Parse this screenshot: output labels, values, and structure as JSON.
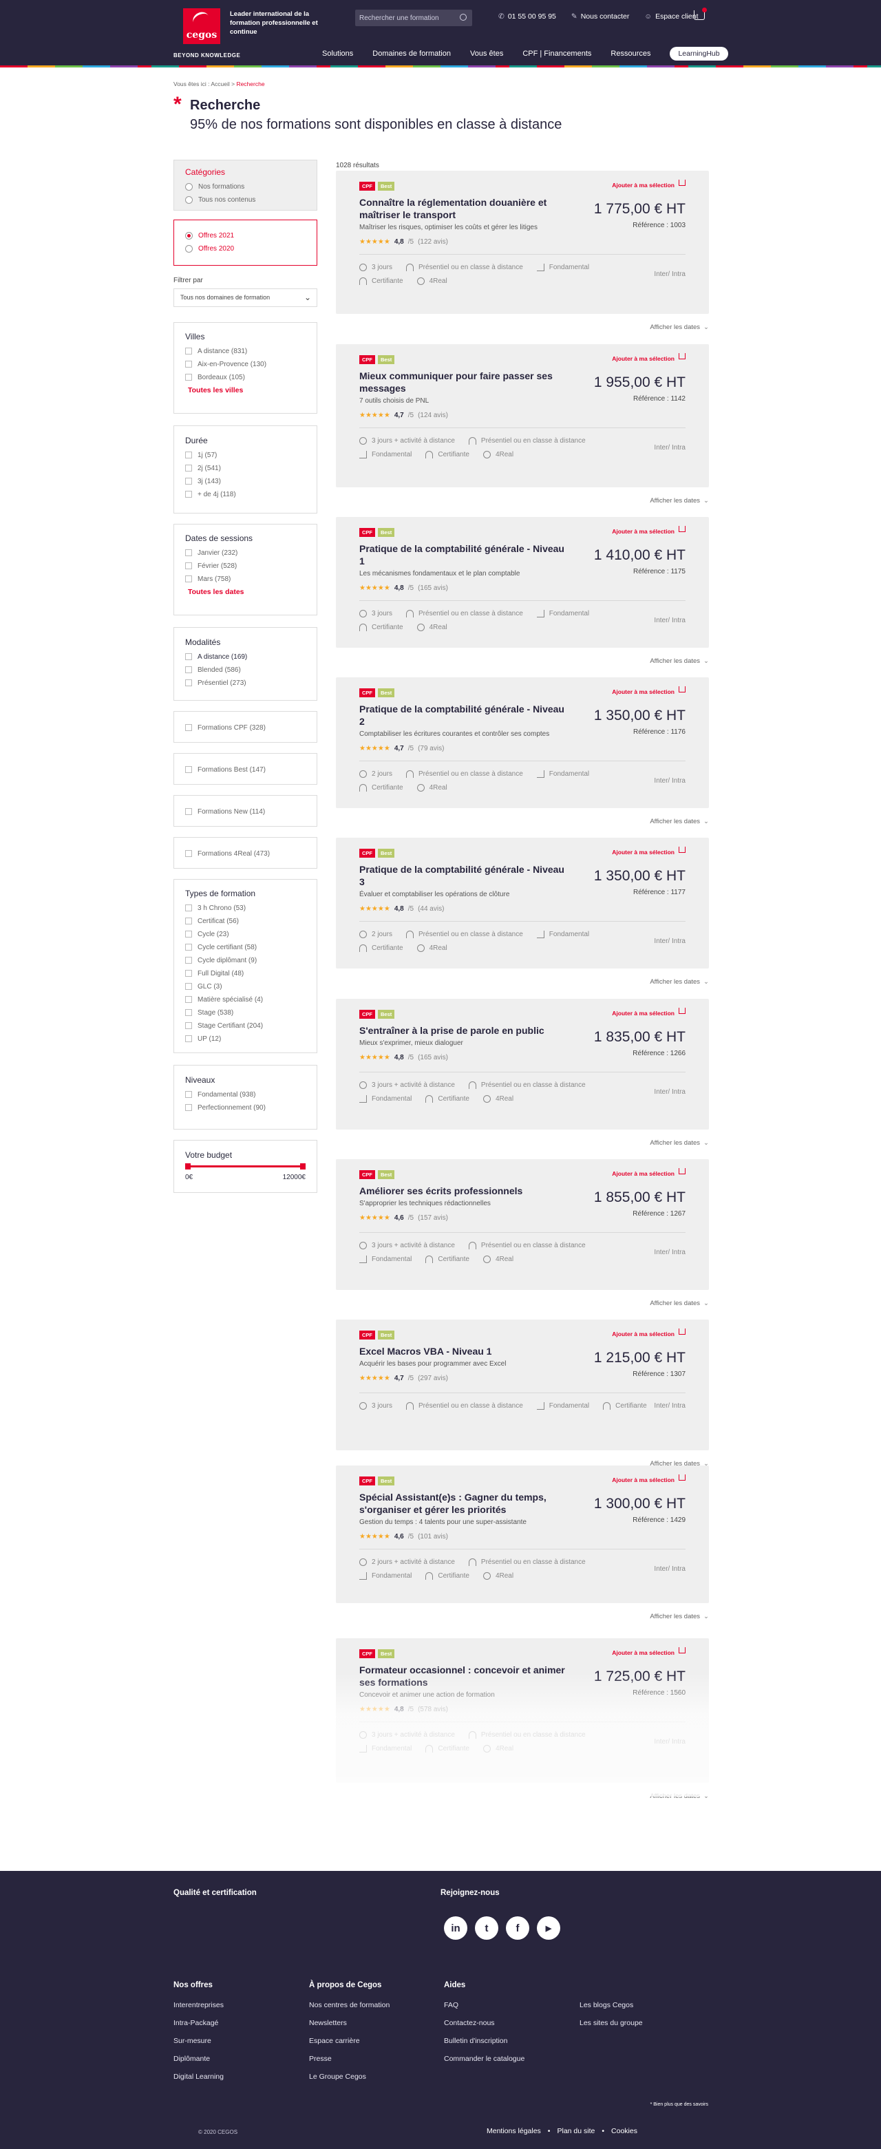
{
  "header": {
    "tagline": "Leader international de la formation professionnelle et continue",
    "logo_text": "cegos",
    "logo_sub": "BEYOND KNOWLEDGE",
    "search_placeholder": "Rechercher une formation",
    "phone": "01 55 00 95 95",
    "contact": "Nous contacter",
    "client": "Espace client",
    "nav": [
      "Solutions",
      "Domaines de formation",
      "Vous êtes",
      "CPF | Financements",
      "Ressources"
    ],
    "hub": "LearningHub"
  },
  "breadcrumb": {
    "prefix": "Vous êtes ici : ",
    "home": "Accueil",
    "sep": " > ",
    "current": "Recherche"
  },
  "page": {
    "title": "Recherche",
    "subtitle": "95% de nos formations sont disponibles en classe à distance",
    "results": "1028 résultats"
  },
  "sidebar": {
    "categories": {
      "title": "Catégories",
      "options": [
        "Nos formations",
        "Tous nos contenus"
      ]
    },
    "offers": [
      "Offres 2021",
      "Offres 2020"
    ],
    "filter_label": "Filtrer par",
    "filter_value": "Tous nos domaines de formation",
    "villes": {
      "title": "Villes",
      "items": [
        "A distance (831)",
        "Aix-en-Provence (130)",
        "Bordeaux (105)"
      ],
      "more": "Toutes les villes"
    },
    "duree": {
      "title": "Durée",
      "items": [
        "1j (57)",
        "2j (541)",
        "3j (143)",
        "+ de 4j (118)"
      ]
    },
    "sessions": {
      "title": "Dates de sessions",
      "items": [
        "Janvier (232)",
        "Février (528)",
        "Mars (758)"
      ],
      "more": "Toutes les dates"
    },
    "modalites": {
      "title": "Modalités",
      "items": [
        "A distance (169)",
        "Blended (586)",
        "Présentiel (273)"
      ]
    },
    "singles": [
      "Formations CPF (328)",
      "Formations Best (147)",
      "Formations New (114)",
      "Formations 4Real (473)"
    ],
    "types": {
      "title": "Types de formation",
      "items": [
        "3 h Chrono (53)",
        "Certificat (56)",
        "Cycle (23)",
        "Cycle certifiant (58)",
        "Cycle diplômant (9)",
        "Full Digital (48)",
        "GLC (3)",
        "Matière spécialisé (4)",
        "Stage (538)",
        "Stage Certifiant (204)",
        "UP (12)"
      ]
    },
    "niveaux": {
      "title": "Niveaux",
      "items": [
        "Fondamental (938)",
        "Perfectionnement (90)"
      ]
    },
    "budget": {
      "title": "Votre budget",
      "min": "0€",
      "max": "12000€"
    }
  },
  "card_common": {
    "cpf": "CPF",
    "best": "Best",
    "add": "Ajouter à ma sélection",
    "inter": "Inter/ Intra",
    "dates": "Afficher les dates",
    "stars": "★★★★★"
  },
  "cards": [
    {
      "title": "Connaître la réglementation douanière et maîtriser le transport",
      "sub": "Maîtriser les risques, optimiser les coûts et gérer les litiges",
      "rating": "4,8",
      "count": "(122 avis)",
      "price": "1 775,00 € HT",
      "ref": "Référence : 1003",
      "meta1": [
        "3 jours",
        "Présentiel ou en classe à distance",
        "Fondamental"
      ],
      "meta2": [
        "Certifiante",
        "4Real"
      ]
    },
    {
      "title": "Mieux communiquer pour faire passer ses messages",
      "sub": "7 outils choisis de PNL",
      "rating": "4,7",
      "count": "(124 avis)",
      "price": "1 955,00 € HT",
      "ref": "Référence : 1142",
      "meta1": [
        "3 jours + activité à distance",
        "Présentiel ou en classe à distance"
      ],
      "meta2": [
        "Fondamental",
        "Certifiante",
        "4Real"
      ]
    },
    {
      "title": "Pratique de la comptabilité générale - Niveau 1",
      "sub": "Les mécanismes fondamentaux et le plan comptable",
      "rating": "4,8",
      "count": "(165 avis)",
      "price": "1 410,00 € HT",
      "ref": "Référence : 1175",
      "meta1": [
        "3 jours",
        "Présentiel ou en classe à distance",
        "Fondamental"
      ],
      "meta2": [
        "Certifiante",
        "4Real"
      ]
    },
    {
      "title": "Pratique de la comptabilité générale - Niveau 2",
      "sub": "Comptabiliser les écritures courantes et contrôler ses comptes",
      "rating": "4,7",
      "count": "(79 avis)",
      "price": "1 350,00 € HT",
      "ref": "Référence : 1176",
      "meta1": [
        "2 jours",
        "Présentiel ou en classe à distance",
        "Fondamental"
      ],
      "meta2": [
        "Certifiante",
        "4Real"
      ]
    },
    {
      "title": "Pratique de la comptabilité générale - Niveau 3",
      "sub": "Évaluer et comptabiliser les opérations de clôture",
      "rating": "4,8",
      "count": "(44 avis)",
      "price": "1 350,00 € HT",
      "ref": "Référence : 1177",
      "meta1": [
        "2 jours",
        "Présentiel ou en classe à distance",
        "Fondamental"
      ],
      "meta2": [
        "Certifiante",
        "4Real"
      ]
    },
    {
      "title": "S'entraîner à la prise de parole en public",
      "sub": "Mieux s'exprimer, mieux dialoguer",
      "rating": "4,8",
      "count": "(165 avis)",
      "price": "1 835,00 € HT",
      "ref": "Référence : 1266",
      "meta1": [
        "3 jours + activité à distance",
        "Présentiel ou en classe à distance"
      ],
      "meta2": [
        "Fondamental",
        "Certifiante",
        "4Real"
      ]
    },
    {
      "title": "Améliorer ses écrits professionnels",
      "sub": "S'approprier les techniques rédactionnelles",
      "rating": "4,6",
      "count": "(157 avis)",
      "price": "1 855,00 € HT",
      "ref": "Référence : 1267",
      "meta1": [
        "3 jours + activité à distance",
        "Présentiel ou en classe à distance"
      ],
      "meta2": [
        "Fondamental",
        "Certifiante",
        "4Real"
      ]
    },
    {
      "title": "Excel Macros VBA - Niveau 1",
      "sub": "Acquérir les bases pour programmer avec Excel",
      "rating": "4,7",
      "count": "(297 avis)",
      "price": "1 215,00 € HT",
      "ref": "Référence : 1307",
      "meta1": [
        "3 jours",
        "Présentiel ou en classe à distance",
        "Fondamental",
        "Certifiante"
      ],
      "meta2": []
    },
    {
      "title": "Spécial Assistant(e)s : Gagner du temps, s'organiser et gérer les priorités",
      "sub": "Gestion du temps : 4 talents pour une super-assistante",
      "rating": "4,6",
      "count": "(101 avis)",
      "price": "1 300,00 € HT",
      "ref": "Référence : 1429",
      "meta1": [
        "2 jours + activité à distance",
        "Présentiel ou en classe à distance"
      ],
      "meta2": [
        "Fondamental",
        "Certifiante",
        "4Real"
      ]
    },
    {
      "title": "Formateur occasionnel : concevoir et animer ses formations",
      "sub": "Concevoir et animer une action de formation",
      "rating": "4,8",
      "count": "(578 avis)",
      "price": "1 725,00 € HT",
      "ref": "Référence : 1560",
      "meta1": [
        "3 jours + activité à distance",
        "Présentiel ou en classe à distance"
      ],
      "meta2": [
        "Fondamental",
        "Certifiante",
        "4Real"
      ]
    }
  ],
  "footer": {
    "quality": "Qualité et certification",
    "join": "Rejoignez-nous",
    "social": [
      "in",
      "t",
      "f",
      "▶"
    ],
    "cols": [
      {
        "title": "Nos offres",
        "links": [
          "Interentreprises",
          "Intra-Packagé",
          "Sur-mesure",
          "Diplômante",
          "Digital Learning"
        ]
      },
      {
        "title": "À propos de Cegos",
        "links": [
          "Nos centres de formation",
          "Newsletters",
          "Espace carrière",
          "Presse",
          "Le Groupe Cegos"
        ]
      },
      {
        "title": "Aides",
        "links": [
          "FAQ",
          "Contactez-nous",
          "Bulletin d'inscription",
          "Commander le catalogue"
        ]
      },
      {
        "title": "",
        "links": [
          "Les blogs Cegos",
          "Les sites du groupe"
        ]
      }
    ],
    "note": "* Bien plus que des savoirs",
    "copyright": "© 2020 CEGOS",
    "legal": [
      "Mentions légales",
      "•",
      "Plan du site",
      "•",
      "Cookies"
    ]
  }
}
